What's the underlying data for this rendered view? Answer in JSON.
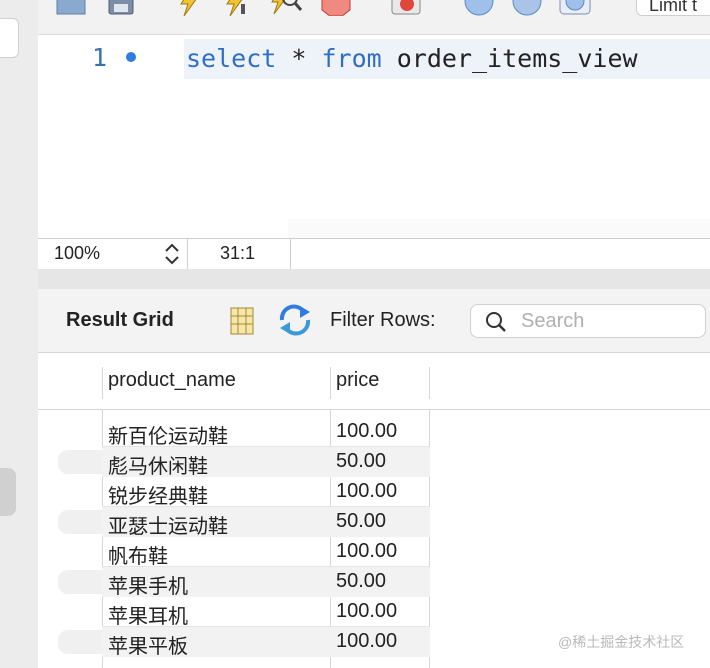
{
  "toolbar": {
    "icons": [
      "folder-icon",
      "save-icon",
      "execute-icon",
      "execute-current-icon",
      "explain-icon",
      "stop-icon",
      "toggle-error-icon",
      "commit-icon",
      "rollback-icon",
      "autocommit-icon"
    ],
    "limit_label": "Limit t"
  },
  "editor": {
    "line_number": "1",
    "keyword_select": "select",
    "star": " * ",
    "keyword_from": "from",
    "table": " order_items_view"
  },
  "statusbar": {
    "zoom": "100%",
    "cursor": "31:1"
  },
  "result": {
    "grid_label": "Result Grid",
    "filter_label": "Filter Rows:",
    "search_placeholder": "Search"
  },
  "grid": {
    "columns": [
      "product_name",
      "price"
    ],
    "rows": [
      {
        "product_name": "新百伦运动鞋",
        "price": "100.00"
      },
      {
        "product_name": "彪马休闲鞋",
        "price": "50.00"
      },
      {
        "product_name": "锐步经典鞋",
        "price": "100.00"
      },
      {
        "product_name": "亚瑟士运动鞋",
        "price": "50.00"
      },
      {
        "product_name": "帆布鞋",
        "price": "100.00"
      },
      {
        "product_name": "苹果手机",
        "price": "50.00"
      },
      {
        "product_name": "苹果耳机",
        "price": "100.00"
      },
      {
        "product_name": "苹果平板",
        "price": "100.00"
      }
    ]
  },
  "watermark": "@稀土掘金技术社区",
  "colors": {
    "keyword": "#2f6ec8",
    "line_number": "#3b6fb5",
    "breakpoint_dot": "#2f7de1"
  }
}
